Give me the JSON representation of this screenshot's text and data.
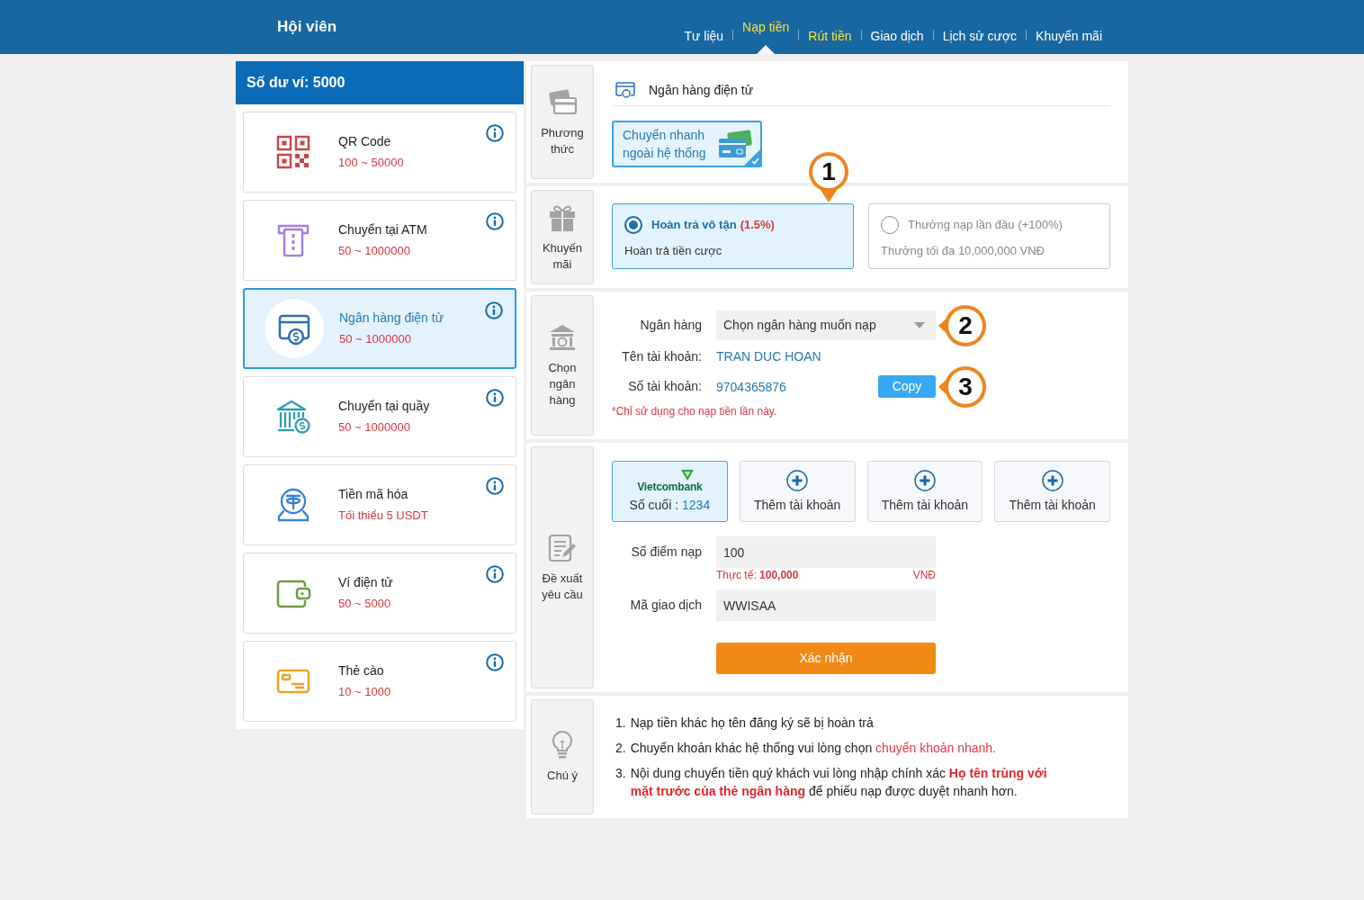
{
  "header": {
    "title": "Hội viên",
    "nav": [
      {
        "label": "Tư liệu",
        "selected": false,
        "highlighted": false
      },
      {
        "label": "Nạp tiền",
        "selected": true,
        "highlighted": true
      },
      {
        "label": "Rút tiền",
        "selected": false,
        "highlighted": true
      },
      {
        "label": "Giao dịch",
        "selected": false,
        "highlighted": false
      },
      {
        "label": "Lịch sử cược",
        "selected": false,
        "highlighted": false
      },
      {
        "label": "Khuyến mãi",
        "selected": false,
        "highlighted": false
      }
    ]
  },
  "wallet": {
    "balance": "Số dư ví: 5000"
  },
  "methods": [
    {
      "kind": "qr",
      "name": "QR Code",
      "range": "100 ~ 50000",
      "selected": false
    },
    {
      "kind": "atm",
      "name": "Chuyển tại ATM",
      "range": "50 ~ 1000000",
      "selected": false
    },
    {
      "kind": "ebank",
      "name": "Ngân hàng điện tử",
      "range": "50 ~ 1000000",
      "selected": true
    },
    {
      "kind": "counter",
      "name": "Chuyển tại quầy",
      "range": "50 ~ 1000000",
      "selected": false
    },
    {
      "kind": "crypto",
      "name": "Tiền mã hóa",
      "range": "Tối thiểu 5 USDT",
      "selected": false
    },
    {
      "kind": "ewallet",
      "name": "Ví điện tử",
      "range": "50 ~ 5000",
      "selected": false
    },
    {
      "kind": "card",
      "name": "Thẻ cào",
      "range": "10 ~ 1000",
      "selected": false
    }
  ],
  "method_section": {
    "label": "Phương thức",
    "title": "Ngân hàng điện tử",
    "options": [
      {
        "label": "Chuyển nhanh ngoài hệ thống",
        "selected": true
      }
    ]
  },
  "promo_section": {
    "label": "Khuyến mãi",
    "callout": "1",
    "options": [
      {
        "title": "Hoàn trả vô tận",
        "rate": "(1.5%)",
        "subtitle": "Hoàn trả tiền cược",
        "selected": true
      },
      {
        "title": "Thưởng nạp lần đầu",
        "rate": "(+100%)",
        "subtitle": "Thưởng tối đa 10,000,000 VNĐ",
        "selected": false
      }
    ]
  },
  "bank_section": {
    "label": "Chọn ngân hàng",
    "fields": [
      {
        "kind": "select",
        "label": "Ngân hàng",
        "placeholder": "Chọn ngân hàng muốn nạp",
        "callout": "2"
      },
      {
        "kind": "text",
        "label": "Tên tài khoản:",
        "value": "TRAN DUC HOAN"
      },
      {
        "kind": "copy",
        "label": "Số tài khoản:",
        "value": "9704365876",
        "button": "Copy",
        "callout": "3"
      }
    ],
    "note": "*Chỉ sử dụng cho nạp tiền lần này."
  },
  "deposit_section": {
    "label": "Đề xuất yêu cầu",
    "accounts": [
      {
        "kind": "bank",
        "bank": "Vietcombank",
        "caption": "Số cuối :",
        "last_digits": "1234",
        "selected": true
      },
      {
        "kind": "add",
        "label": "Thêm tài khoản",
        "selected": false
      },
      {
        "kind": "add",
        "label": "Thêm tài khoản",
        "selected": false
      },
      {
        "kind": "add",
        "label": "Thêm tài khoản",
        "selected": false
      }
    ],
    "amount": {
      "label": "Số điểm nạp",
      "value": "100",
      "actual": "Thực tế: **100,000**",
      "currency": "VNĐ"
    },
    "transaction": {
      "label": "Mã giao dịch",
      "value": "WWISAA"
    },
    "submit": "Xác nhận"
  },
  "notes_section": {
    "label": "Chú ý",
    "items": [
      {
        "number": "1.",
        "text": "Nạp tiền khác họ tên đăng ký sẽ bị hoàn trả"
      },
      {
        "number": "2.",
        "text": "Chuyển khoản khác hệ thống vui lòng chọn",
        "link": "chuyển khoản nhanh."
      },
      {
        "number": "3.",
        "text": "Nội dung chuyển tiền quý khách vui lòng nhập chính xác **Họ tên trùng với mặt trước của thẻ ngân hàng** để phiếu nạp được duyệt nhanh hơn."
      }
    ]
  }
}
